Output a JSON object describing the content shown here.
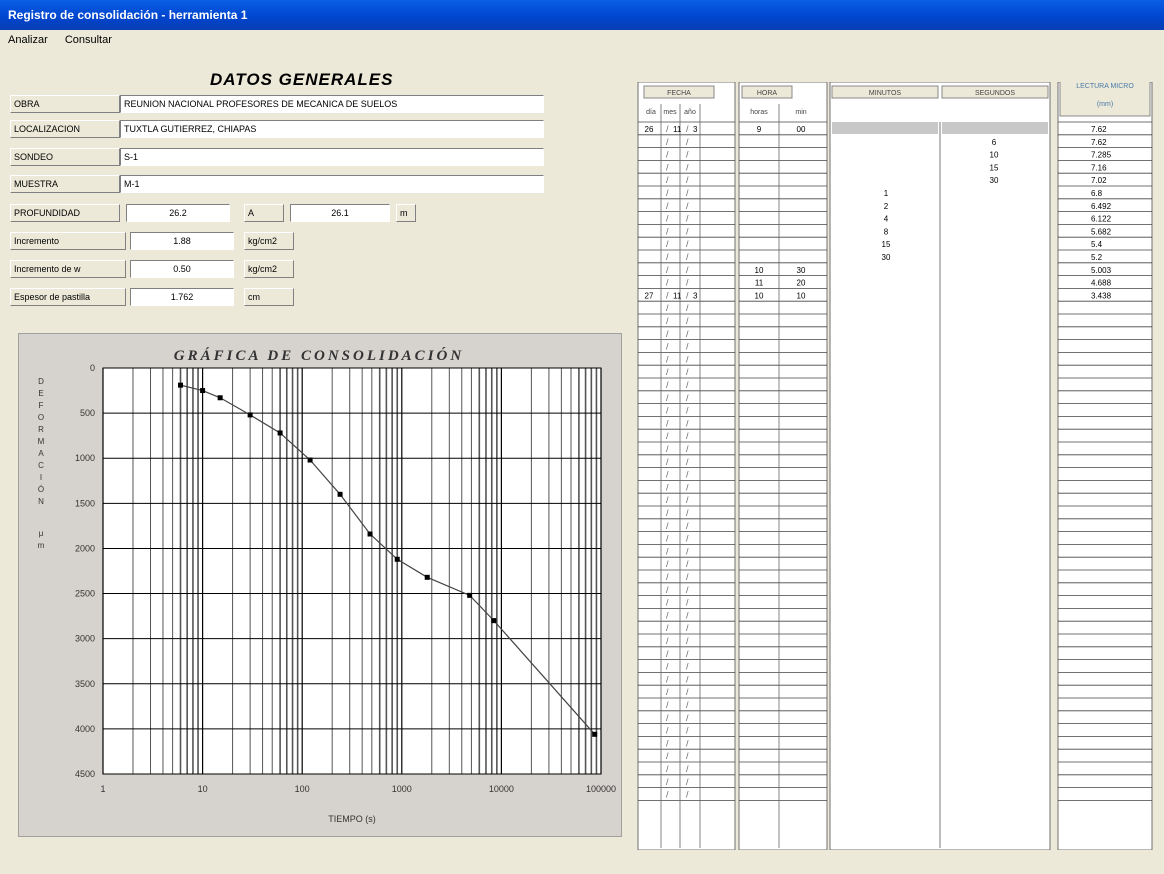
{
  "window": {
    "title": "Registro de consolidación - herramienta 1"
  },
  "menu": {
    "items": [
      "Analizar",
      "Consultar"
    ]
  },
  "datos": {
    "heading": "DATOS GENERALES",
    "obra_label": "OBRA",
    "obra_value": "REUNION NACIONAL PROFESORES DE MECANICA DE SUELOS",
    "localizacion_label": "LOCALIZACION",
    "localizacion_value": "TUXTLA GUTIERREZ, CHIAPAS",
    "sondeo_label": "SONDEO",
    "sondeo_value": "S-1",
    "muestra_label": "MUESTRA",
    "muestra_value": "M-1",
    "profundidad_label": "PROFUNDIDAD",
    "prof_de": "26.2",
    "a_label": "A",
    "prof_a": "26.1",
    "m_unit": "m",
    "incremento_label": "Incremento",
    "incremento_value": "1.88",
    "incremento_unit": "kg/cm2",
    "nuevo_label": "Incremento de w",
    "nuevo_value": "0.50",
    "nuevo_unit": "kg/cm2",
    "espesor_label": "Espesor de pastilla",
    "espesor_value": "1.762",
    "espesor_unit": "cm"
  },
  "chart_data": {
    "type": "line",
    "title": "GRÁFICA DE CONSOLIDACIÓN",
    "xlabel": "TIEMPO (s)",
    "ylabel": "DEFORMACIÓN μm",
    "xscale": "log",
    "xlim": [
      1,
      100000
    ],
    "ylim": [
      0,
      4500
    ],
    "yreversed": true,
    "x_ticks": [
      "1",
      "10",
      "100",
      "1000",
      "10000",
      "100000"
    ],
    "y_ticks": [
      "0",
      "500",
      "1000",
      "1500",
      "2000",
      "2500",
      "3000",
      "3500",
      "4000",
      "4500"
    ],
    "grid": true,
    "series": [
      {
        "x": [
          6,
          10,
          15,
          30,
          60,
          120,
          240,
          480,
          900,
          1800,
          4800,
          8400,
          86400
        ],
        "y": [
          190,
          250,
          330,
          520,
          720,
          1020,
          1400,
          1840,
          2120,
          2320,
          2520,
          2800,
          4060
        ]
      }
    ]
  },
  "registro": {
    "headers": {
      "fecha": "FECHA",
      "hora": "HORA",
      "minutos": "MINUTOS",
      "segundos": "SEGUNDOS",
      "lectura": "LECTURA MICRO",
      "lectura_unit": "(mm)"
    },
    "sub": {
      "dia": "día",
      "mes": "mes",
      "anio": "año",
      "horas": "horas",
      "min": "min"
    },
    "rows": [
      {
        "dia": "26",
        "mes": "11",
        "anio": "3",
        "horas": "9",
        "min": "00",
        "minutos": "",
        "segundos": "",
        "lectura": "7.62"
      },
      {
        "dia": "",
        "mes": "",
        "anio": "",
        "horas": "",
        "min": "",
        "minutos": "",
        "segundos": "6",
        "lectura": "7.62"
      },
      {
        "dia": "",
        "mes": "",
        "anio": "",
        "horas": "",
        "min": "",
        "minutos": "",
        "segundos": "10",
        "lectura": "7.285"
      },
      {
        "dia": "",
        "mes": "",
        "anio": "",
        "horas": "",
        "min": "",
        "minutos": "",
        "segundos": "15",
        "lectura": "7.16"
      },
      {
        "dia": "",
        "mes": "",
        "anio": "",
        "horas": "",
        "min": "",
        "minutos": "",
        "segundos": "30",
        "lectura": "7.02"
      },
      {
        "dia": "",
        "mes": "",
        "anio": "",
        "horas": "",
        "min": "",
        "minutos": "1",
        "segundos": "",
        "lectura": "6.8"
      },
      {
        "dia": "",
        "mes": "",
        "anio": "",
        "horas": "",
        "min": "",
        "minutos": "2",
        "segundos": "",
        "lectura": "6.492"
      },
      {
        "dia": "",
        "mes": "",
        "anio": "",
        "horas": "",
        "min": "",
        "minutos": "4",
        "segundos": "",
        "lectura": "6.122"
      },
      {
        "dia": "",
        "mes": "",
        "anio": "",
        "horas": "",
        "min": "",
        "minutos": "8",
        "segundos": "",
        "lectura": "5.682"
      },
      {
        "dia": "",
        "mes": "",
        "anio": "",
        "horas": "",
        "min": "",
        "minutos": "15",
        "segundos": "",
        "lectura": "5.4"
      },
      {
        "dia": "",
        "mes": "",
        "anio": "",
        "horas": "",
        "min": "",
        "minutos": "30",
        "segundos": "",
        "lectura": "5.2"
      },
      {
        "dia": "",
        "mes": "",
        "anio": "",
        "horas": "10",
        "min": "30",
        "minutos": "",
        "segundos": "",
        "lectura": "5.003"
      },
      {
        "dia": "",
        "mes": "",
        "anio": "",
        "horas": "11",
        "min": "20",
        "minutos": "",
        "segundos": "",
        "lectura": "4.688"
      },
      {
        "dia": "27",
        "mes": "11",
        "anio": "3",
        "horas": "10",
        "min": "10",
        "minutos": "",
        "segundos": "",
        "lectura": "3.438"
      }
    ],
    "empty_rows": 39,
    "row_slash": "/"
  }
}
